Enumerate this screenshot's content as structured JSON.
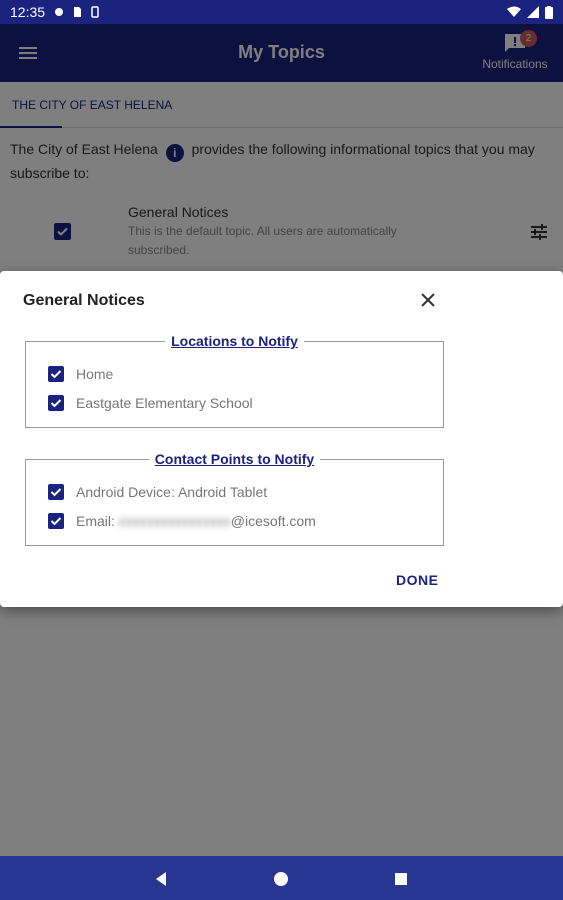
{
  "status_bar": {
    "time": "12:35"
  },
  "app_bar": {
    "title": "My Topics",
    "notifications_label": "Notifications",
    "notifications_count": "2"
  },
  "tabs": [
    {
      "label": "THE CITY OF EAST HELENA"
    }
  ],
  "intro": {
    "org": "The City of East Helena",
    "text": "provides the following informational topics that you may subscribe to:"
  },
  "topic": {
    "title": "General Notices",
    "description": "This is the default topic. All users are automatically subscribed."
  },
  "dialog": {
    "title": "General Notices",
    "locations": {
      "label": "Locations to Notify",
      "items": [
        {
          "label": "Home",
          "checked": true
        },
        {
          "label": "Eastgate Elementary School",
          "checked": true
        }
      ]
    },
    "contacts": {
      "label": "Contact Points to Notify",
      "items": [
        {
          "label": "Android Device: Android Tablet",
          "checked": true
        },
        {
          "prefix": "Email: ",
          "suffix": "@icesoft.com",
          "checked": true
        }
      ]
    },
    "done_label": "DONE"
  },
  "colors": {
    "primary": "#1a237e",
    "badge": "#d15b5b",
    "nav": "#283593"
  }
}
